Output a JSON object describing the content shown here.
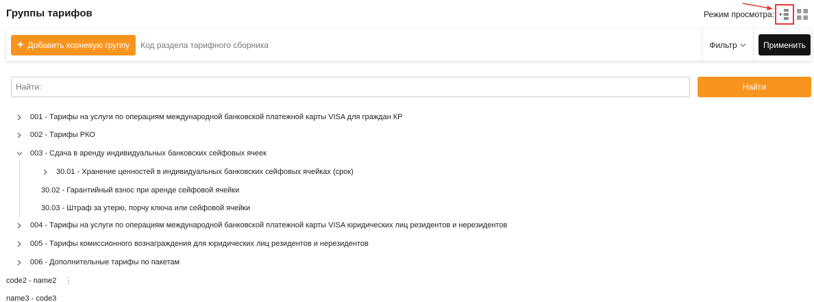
{
  "header": {
    "title": "Группы тарифов",
    "view_mode_label": "Режим просмотра:",
    "view_modes": [
      {
        "icon": "tree-view-icon",
        "active": true
      },
      {
        "icon": "grid-view-icon",
        "active": false
      }
    ],
    "annotation_color": "#e53935"
  },
  "toolbar": {
    "add_root_label": "Добавить корневую группу",
    "code_placeholder": "Код раздела тарифного сборника",
    "filter_label": "Фильтр",
    "apply_label": "Применить"
  },
  "search": {
    "placeholder": "Найти:",
    "button_label": "Найти"
  },
  "colors": {
    "accent": "#f7941e",
    "dark": "#141414"
  },
  "tree": [
    {
      "label": "001 - Тарифы на услуги по операциям международной банковской платежной карты VISA для граждан КР",
      "chevron": "right",
      "level": 0
    },
    {
      "label": "002 - Тарифы РКО",
      "chevron": "right",
      "level": 0
    },
    {
      "label": "003 - Сдача в аренду индивидуальных банковских сейфовых ячеек",
      "chevron": "down",
      "level": 0
    },
    {
      "label": "30.01 - Хранение ценностей в индивидуальных банковских сейфовых ячейках (срок)",
      "chevron": "right",
      "level": 1
    },
    {
      "label": "30.02 - Гарантийный взнос при аренде сейфовой ячейки",
      "chevron": "none",
      "level": 1
    },
    {
      "label": "30.03 - Штраф за утерю, порчу ключа или сейфовой ячейки",
      "chevron": "none",
      "level": 1
    },
    {
      "label": "004 - Тарифы на услуги по операциям международной банковской платежной карты VISA юридических лиц резидентов и нерезидентов",
      "chevron": "right",
      "level": 0
    },
    {
      "label": "005 - Тарифы комиссионного вознаграждения для юридических лиц резидентов и нерезидентов",
      "chevron": "right",
      "level": 0
    },
    {
      "label": "006 - Дополнительные тарифы по пакетам",
      "chevron": "right",
      "level": 0
    },
    {
      "label": "code2 - name2",
      "chevron": "none",
      "level": 0,
      "menu": "kebab-menu-icon"
    },
    {
      "label": "name3 - code3",
      "chevron": "none",
      "level": 0
    }
  ]
}
